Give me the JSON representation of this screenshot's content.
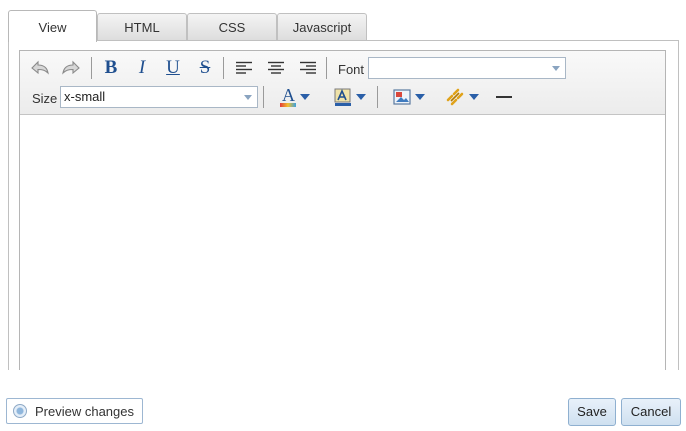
{
  "tabs": [
    {
      "label": "View",
      "active": true
    },
    {
      "label": "HTML",
      "active": false
    },
    {
      "label": "CSS",
      "active": false
    },
    {
      "label": "Javascript",
      "active": false
    }
  ],
  "toolbar": {
    "undo_icon": "undo-icon",
    "redo_icon": "redo-icon",
    "bold_glyph": "B",
    "italic_glyph": "I",
    "underline_glyph": "U",
    "strike_glyph": "S",
    "font_label": "Font",
    "font_value": "",
    "size_label": "Size",
    "size_value": "x-small",
    "font_color_glyph": "A",
    "accent_color": "#1f4f8f"
  },
  "footer": {
    "preview_label": "Preview changes",
    "save_label": "Save",
    "cancel_label": "Cancel"
  }
}
